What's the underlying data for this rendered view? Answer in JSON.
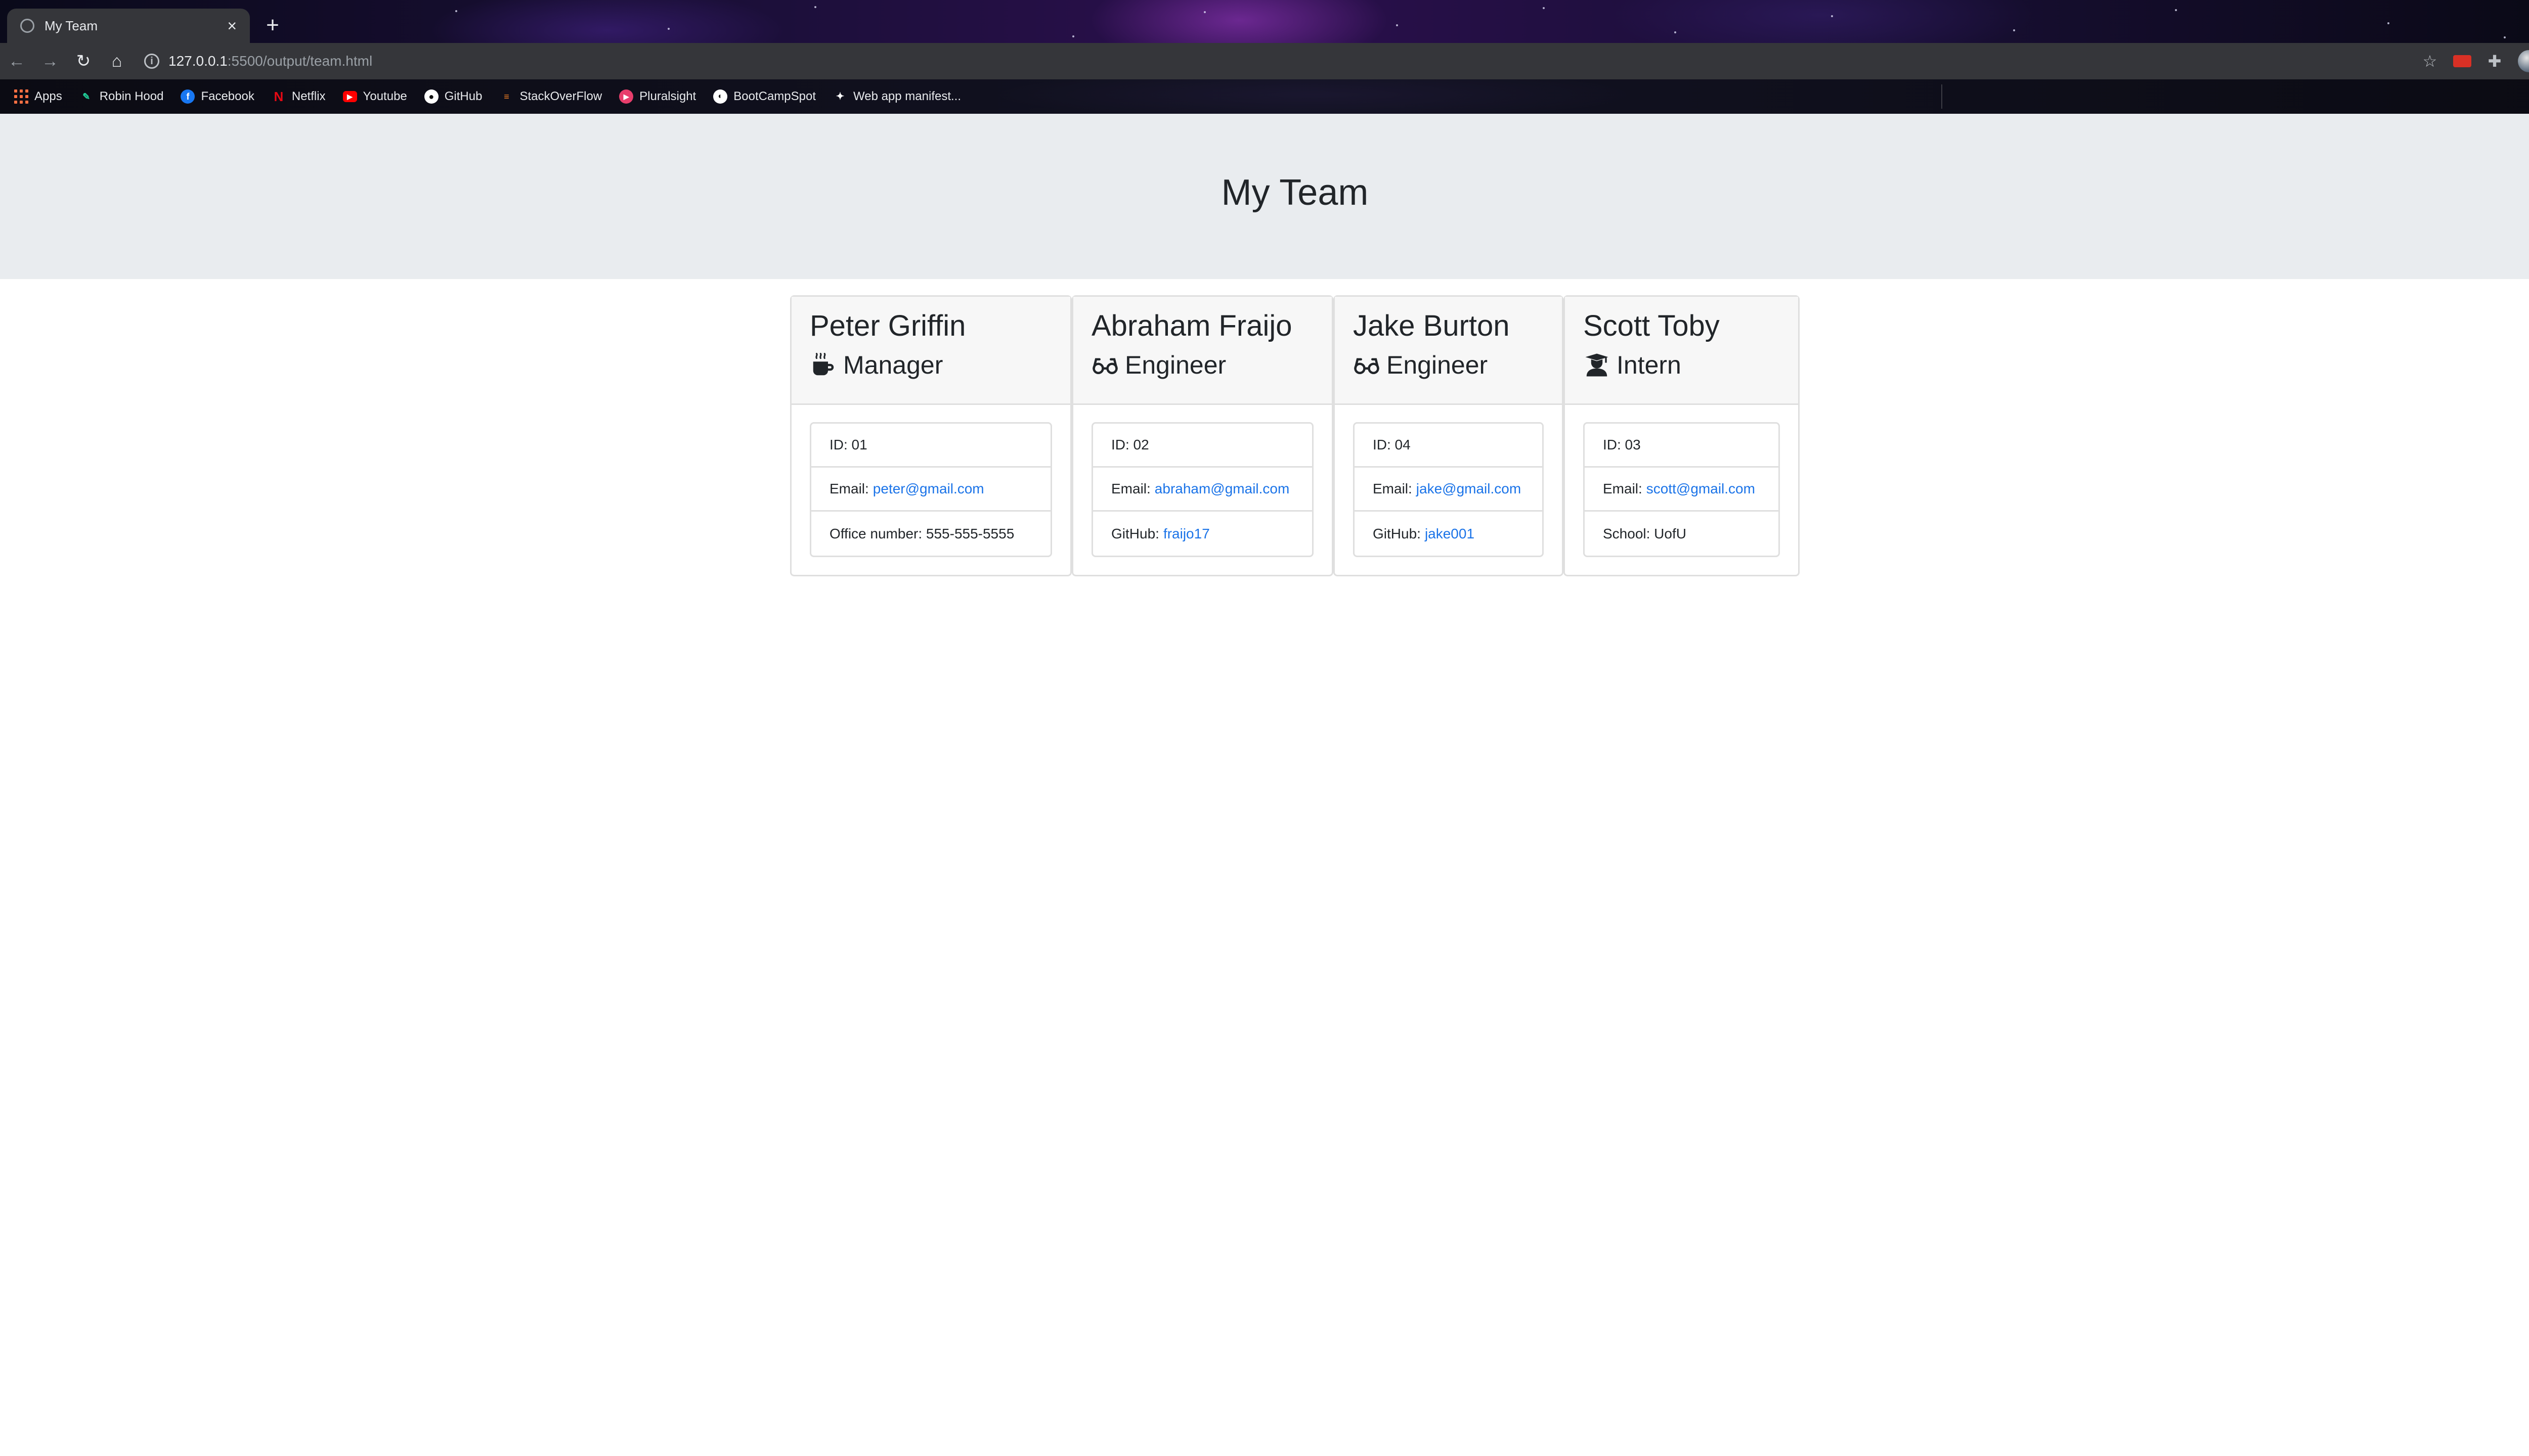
{
  "browser": {
    "tab_title": "My Team",
    "url_host": "127.0.0.1",
    "url_rest": ":5500/output/team.html",
    "bookmarks": [
      {
        "label": "Apps",
        "icon": "apps-grid-icon",
        "color": "#ff7043"
      },
      {
        "label": "Robin Hood",
        "icon": "robinhood-feather-icon",
        "color": "#21ce99"
      },
      {
        "label": "Facebook",
        "icon": "facebook-icon",
        "color": "#1877f2"
      },
      {
        "label": "Netflix",
        "icon": "netflix-icon",
        "color": "#e50914"
      },
      {
        "label": "Youtube",
        "icon": "youtube-icon",
        "color": "#ff0000"
      },
      {
        "label": "GitHub",
        "icon": "github-icon",
        "color": "#ffffff"
      },
      {
        "label": "StackOverFlow",
        "icon": "stackoverflow-icon",
        "color": "#f48024"
      },
      {
        "label": "Pluralsight",
        "icon": "pluralsight-icon",
        "color": "#f15b2a"
      },
      {
        "label": "BootCampSpot",
        "icon": "bootcampspot-icon",
        "color": "#ffffff"
      },
      {
        "label": "Web app manifest...",
        "icon": "manifest-icon",
        "color": "#ffffff"
      }
    ]
  },
  "page": {
    "title": "My Team"
  },
  "team": [
    {
      "name": "Peter Griffin",
      "role": "Manager",
      "role_icon": "mug-icon",
      "id_label": "ID: 01",
      "email_label": "Email:",
      "email": "peter@gmail.com",
      "extra_label": "Office number: 555-555-5555",
      "extra_link": ""
    },
    {
      "name": "Abraham Fraijo",
      "role": "Engineer",
      "role_icon": "glasses-icon",
      "id_label": "ID: 02",
      "email_label": "Email:",
      "email": "abraham@gmail.com",
      "extra_label": "GitHub:",
      "extra_link": "fraijo17"
    },
    {
      "name": "Jake Burton",
      "role": "Engineer",
      "role_icon": "glasses-icon",
      "id_label": "ID: 04",
      "email_label": "Email:",
      "email": "jake@gmail.com",
      "extra_label": "GitHub:",
      "extra_link": "jake001"
    },
    {
      "name": "Scott Toby",
      "role": "Intern",
      "role_icon": "graduate-icon",
      "id_label": "ID: 03",
      "email_label": "Email:",
      "email": "scott@gmail.com",
      "extra_label": "School: UofU",
      "extra_link": ""
    }
  ],
  "colors": {
    "link": "#1a73e8",
    "jumbotron": "#e9ecef",
    "card_header": "#f7f7f7"
  }
}
